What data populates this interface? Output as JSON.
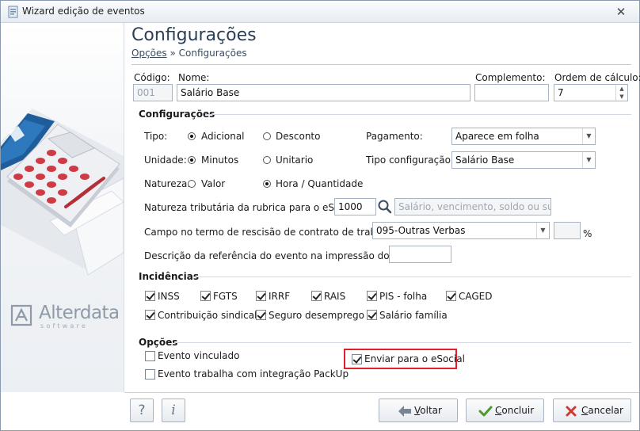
{
  "window": {
    "title": "Wizard edição de eventos",
    "close": "✕"
  },
  "header": {
    "title": "Configurações",
    "breadcrumb_link": "Opções",
    "breadcrumb_sep": " » ",
    "breadcrumb_current": "Configurações"
  },
  "fields": {
    "codigo_label": "Código:",
    "codigo_value": "001",
    "nome_label": "Nome:",
    "nome_value": "Salário Base",
    "complemento_label": "Complemento:",
    "complemento_value": "",
    "ordem_label": "Ordem de cálculo:",
    "ordem_value": "7"
  },
  "config": {
    "section": "Configurações",
    "tipo_label": "Tipo:",
    "tipo_options": [
      "Adicional",
      "Desconto"
    ],
    "tipo_selected": "Adicional",
    "unidade_label": "Unidade:",
    "unidade_options": [
      "Minutos",
      "Unitario"
    ],
    "unidade_selected": "Minutos",
    "natureza_label": "Natureza:",
    "natureza_options": [
      "Valor",
      "Hora / Quantidade"
    ],
    "natureza_selected": "Hora / Quantidade",
    "pagamento_label": "Pagamento:",
    "pagamento_value": "Aparece em folha",
    "tipo_config_label": "Tipo configuração:",
    "tipo_config_value": "Salário Base",
    "natureza_trib_label": "Natureza tributária da rubrica para o eSocial:",
    "natureza_trib_value": "1000",
    "natureza_trib_placeholder": "Salário, vencimento, soldo ou subsídio",
    "campo_label": "Campo no termo de rescisão de contrato de trabalho:",
    "campo_value": "095-Outras Verbas",
    "percent_symbol": "%",
    "descricao_label": "Descrição da referência do evento na impressão do TRCT:",
    "descricao_value": ""
  },
  "incidencias": {
    "section": "Incidências",
    "items": [
      {
        "label": "INSS",
        "checked": true
      },
      {
        "label": "FGTS",
        "checked": true
      },
      {
        "label": "IRRF",
        "checked": true
      },
      {
        "label": "RAIS",
        "checked": true
      },
      {
        "label": "PIS - folha",
        "checked": true
      },
      {
        "label": "CAGED",
        "checked": true
      },
      {
        "label": "Contribuição sindical",
        "checked": true
      },
      {
        "label": "Seguro desemprego",
        "checked": true
      },
      {
        "label": "Salário família",
        "checked": true
      }
    ]
  },
  "opcoes": {
    "section": "Opções",
    "evento_vinculado": "Evento vinculado",
    "packup": "Evento trabalha com integração PackUp",
    "esocial": "Enviar para o eSocial"
  },
  "footer": {
    "help": "?",
    "info": "i",
    "voltar_key": "V",
    "voltar_rest": "oltar",
    "concluir_key": "C",
    "concluir_rest": "oncluir",
    "cancelar_key": "C",
    "cancelar_rest": "ancelar"
  },
  "logo": {
    "name": "Alterdata",
    "sub": "software"
  },
  "colors": {
    "accent": "#2b3f55",
    "highlight": "#e0202a",
    "cancel_red": "#d03a2e",
    "confirm_green": "#4c9a2a"
  }
}
